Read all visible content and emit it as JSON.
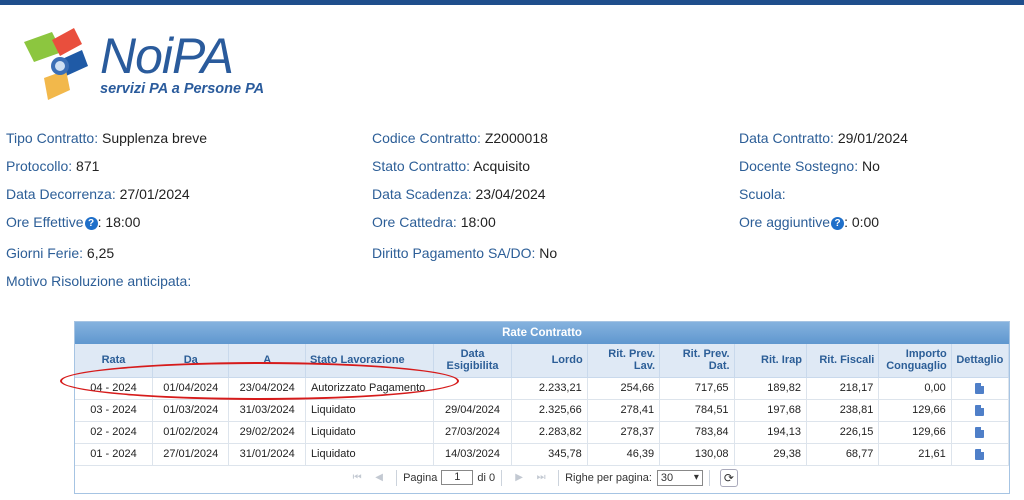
{
  "logo": {
    "word": "NoiPA",
    "tagline": "servizi PA a Persone PA"
  },
  "fields": {
    "tipo_contratto": {
      "label": "Tipo Contratto:",
      "value": "Supplenza breve"
    },
    "codice_contratto": {
      "label": "Codice Contratto:",
      "value": "Z2000018"
    },
    "data_contratto": {
      "label": "Data Contratto:",
      "value": "29/01/2024"
    },
    "protocollo": {
      "label": "Protocollo:",
      "value": "871"
    },
    "stato_contratto": {
      "label": "Stato Contratto:",
      "value": "Acquisito"
    },
    "docente_sostegno": {
      "label": "Docente Sostegno:",
      "value": "No"
    },
    "data_decorrenza": {
      "label": "Data Decorrenza:",
      "value": "27/01/2024"
    },
    "data_scadenza": {
      "label": "Data Scadenza:",
      "value": "23/04/2024"
    },
    "scuola": {
      "label": "Scuola:",
      "value": ""
    },
    "ore_effettive": {
      "label": "Ore Effettive",
      "value": "18:00"
    },
    "ore_cattedra": {
      "label": "Ore Cattedra:",
      "value": "18:00"
    },
    "ore_aggiuntive": {
      "label": "Ore aggiuntive",
      "value": "0:00"
    },
    "giorni_ferie": {
      "label": "Giorni Ferie:",
      "value": "6,25"
    },
    "diritto_pagamento": {
      "label": "Diritto Pagamento SA/DO:",
      "value": "No"
    },
    "motivo_risoluzione": {
      "label": "Motivo Risoluzione anticipata:",
      "value": ""
    }
  },
  "table": {
    "title": "Rate Contratto",
    "headers": [
      "Rata",
      "Da",
      "A",
      "Stato Lavorazione",
      "Data\nEsigibilita",
      "Lordo",
      "Rit. Prev.\nLav.",
      "Rit. Prev.\nDat.",
      "Rit. Irap",
      "Rit. Fiscali",
      "Importo\nConguaglio",
      "Dettaglio"
    ],
    "rows": [
      [
        "04 - 2024",
        "01/04/2024",
        "23/04/2024",
        "Autorizzato Pagamento",
        "",
        "2.233,21",
        "254,66",
        "717,65",
        "189,82",
        "218,17",
        "0,00"
      ],
      [
        "03 - 2024",
        "01/03/2024",
        "31/03/2024",
        "Liquidato",
        "29/04/2024",
        "2.325,66",
        "278,41",
        "784,51",
        "197,68",
        "238,81",
        "129,66"
      ],
      [
        "02 - 2024",
        "01/02/2024",
        "29/02/2024",
        "Liquidato",
        "27/03/2024",
        "2.283,82",
        "278,37",
        "783,84",
        "194,13",
        "226,15",
        "129,66"
      ],
      [
        "01 - 2024",
        "27/01/2024",
        "31/01/2024",
        "Liquidato",
        "14/03/2024",
        "345,78",
        "46,39",
        "130,08",
        "29,38",
        "68,77",
        "21,61"
      ]
    ]
  },
  "pager": {
    "page_label": "Pagina",
    "page_value": "1",
    "of_label": "di 0",
    "rows_label": "Righe per pagina:",
    "rows_value": "30"
  },
  "colors": {
    "topbar": "#1f4e8c",
    "label": "#2c5e97",
    "annotation": "#d61b1b"
  }
}
